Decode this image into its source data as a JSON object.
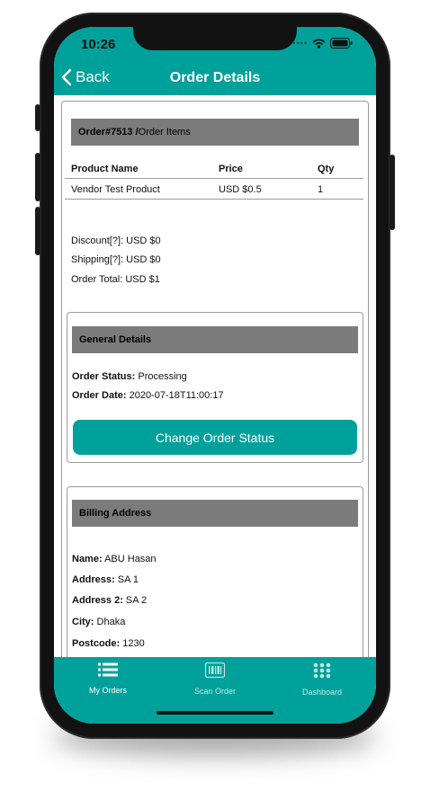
{
  "status_bar": {
    "time": "10:26"
  },
  "nav": {
    "back_label": "Back",
    "title": "Order Details"
  },
  "order_items": {
    "heading_id": "Order#7513 /",
    "heading_rest": " Order Items",
    "columns": [
      "Product Name",
      "Price",
      "Qty"
    ],
    "rows": [
      {
        "product": "Vendor Test Product",
        "price": "USD $0.5",
        "qty": "1"
      }
    ]
  },
  "totals": {
    "discount": "Discount[?]: USD $0",
    "shipping": "Shipping[?]: USD $0",
    "order_total": "Order Total: USD $1"
  },
  "general_details": {
    "heading": "General Details",
    "status_label": "Order Status:",
    "status_value": " Processing",
    "date_label": "Order Date:",
    "date_value": " 2020-07-18T11:00:17",
    "button_label": "Change Order Status"
  },
  "billing": {
    "heading": "Billing Address",
    "name_label": "Name:",
    "name_value": " ABU Hasan",
    "address_label": "Address:",
    "address_value": " SA 1",
    "address2_label": "Address 2:",
    "address2_value": " SA 2",
    "city_label": "City:",
    "city_value": " Dhaka",
    "postcode_label": "Postcode:",
    "postcode_value": " 1230"
  },
  "tabs": [
    {
      "label": "My Orders",
      "icon": "list-icon",
      "active": true
    },
    {
      "label": "Scan Order",
      "icon": "barcode-icon",
      "active": false
    },
    {
      "label": "Dashboard",
      "icon": "grid-icon",
      "active": false
    }
  ],
  "colors": {
    "accent": "#00a19a",
    "header_bar": "#7b7b7b",
    "tab_active": "#ffffff",
    "tab_inactive": "#bfe8e6"
  }
}
